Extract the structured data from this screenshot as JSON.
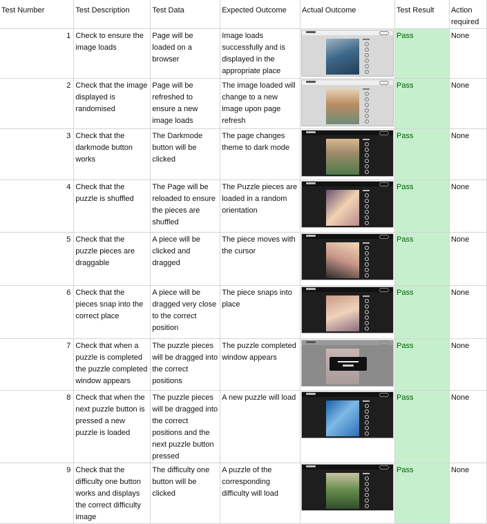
{
  "headers": [
    "Test Number",
    "Test Description",
    "Test Data",
    "Expected Outcome",
    "Actual Outcome",
    "Test Result",
    "Action required"
  ],
  "rows": [
    {
      "num": "1",
      "desc": "Check to ensure the image loads",
      "data": "Page will be loaded on a browser",
      "expected": "Image loads successfully and is displayed in the appropriate place",
      "result": "Pass",
      "action": "None"
    },
    {
      "num": "2",
      "desc": "Check that the image displayed is randomised",
      "data": "Page will be refreshed to ensure a new image loads",
      "expected": "The image loaded will change to a new image upon page refresh",
      "result": "Pass",
      "action": "None"
    },
    {
      "num": "3",
      "desc": "Check that the darkmode button works",
      "data": "The Darkmode button will be clicked",
      "expected": "The page changes theme to dark mode",
      "result": "Pass",
      "action": "None"
    },
    {
      "num": "4",
      "desc": "Check that the puzzle is shuffled",
      "data": "The Page will be reloaded to ensure the pieces are shuffled",
      "expected": "The Puzzle pieces are loaded in a random orientation",
      "result": "Pass",
      "action": "None"
    },
    {
      "num": "5",
      "desc": "Check that the puzzle pieces are draggable",
      "data": "A piece will be clicked and dragged",
      "expected": "The piece moves with the cursor",
      "result": "Pass",
      "action": "None"
    },
    {
      "num": "6",
      "desc": "Check that the pieces snap into the correct place",
      "data": "A piece will be dragged very close to the correct position",
      "expected": "The piece snaps into place",
      "result": "Pass",
      "action": "None"
    },
    {
      "num": "7",
      "desc": "Check that when a puzzle is completed the puzzle completed window appears",
      "data": "The puzzle pieces will be dragged into the correct positions",
      "expected": "The puzzle completed window appears",
      "result": "Pass",
      "action": "None"
    },
    {
      "num": "8",
      "desc": "Check that when the next puzzle button is pressed a new puzzle is loaded",
      "data": "The puzzle pieces will be dragged into the correct positions and the next puzzle button pressed",
      "expected": "A new puzzle will load",
      "result": "Pass",
      "action": "None"
    },
    {
      "num": "9",
      "desc": "Check that the difficulty one button works and displays the correct difficulty image",
      "data": "The difficulty one button will be clicked",
      "expected": "A puzzle of the corresponding difficulty will load",
      "result": "Pass",
      "action": "None"
    }
  ]
}
